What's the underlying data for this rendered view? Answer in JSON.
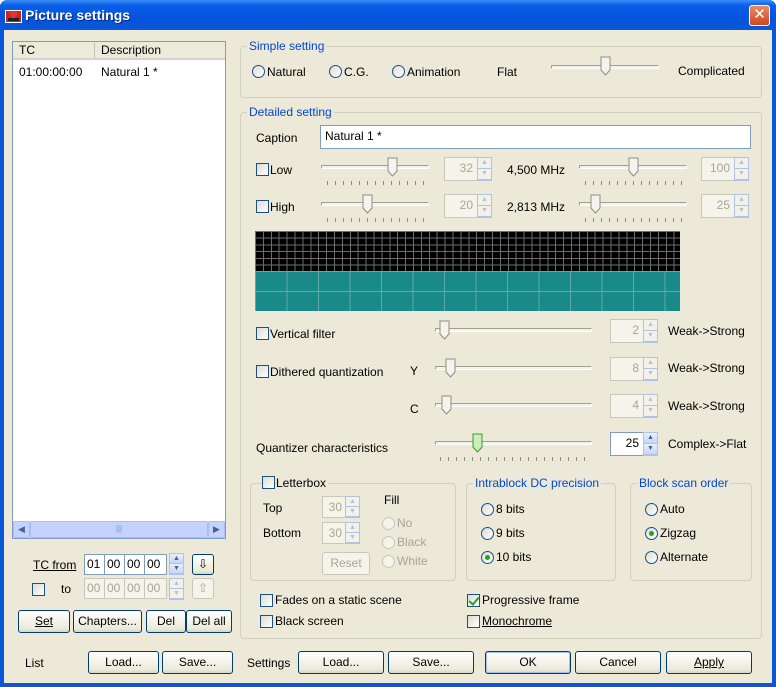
{
  "window": {
    "title": "Picture settings",
    "close_glyph": "✕"
  },
  "list": {
    "headers": [
      "TC",
      "Description"
    ],
    "rows": [
      {
        "tc": "01:00:00:00",
        "description": "Natural 1 *"
      }
    ],
    "tc_from_label": "TC from",
    "to_label": "to",
    "from_fields": [
      "01",
      "00",
      "00",
      "00"
    ],
    "to_fields": [
      "00",
      "00",
      "00",
      "00"
    ],
    "set_label": "Set",
    "chapters_label": "Chapters...",
    "del_label": "Del",
    "del_all_label": "Del all",
    "section_label": "List",
    "load_label": "Load...",
    "save_label": "Save..."
  },
  "simple": {
    "title": "Simple setting",
    "options": [
      "Natural",
      "C.G.",
      "Animation"
    ],
    "flat_label": "Flat",
    "complicated_label": "Complicated"
  },
  "detailed": {
    "title": "Detailed setting",
    "caption_label": "Caption",
    "caption_value": "Natural 1 *",
    "low": {
      "label": "Low",
      "value1": "32",
      "freq": "4,500 MHz",
      "value2": "100"
    },
    "high": {
      "label": "High",
      "value1": "20",
      "freq": "2,813 MHz",
      "value2": "25"
    },
    "vertical_filter": {
      "label": "Vertical filter",
      "value": "2",
      "range": "Weak->Strong"
    },
    "dithered": {
      "label": "Dithered quantization",
      "y_label": "Y",
      "y_value": "8",
      "c_label": "C",
      "c_value": "4",
      "range": "Weak->Strong"
    },
    "quantizer": {
      "label": "Quantizer characteristics",
      "value": "25",
      "range": "Complex->Flat"
    },
    "letterbox": {
      "label": "Letterbox",
      "top_label": "Top",
      "top_value": "30",
      "bottom_label": "Bottom",
      "bottom_value": "30",
      "fill_label": "Fill",
      "fill_options": [
        "No",
        "Black",
        "White"
      ],
      "reset_label": "Reset"
    },
    "intrablock": {
      "title": "Intrablock DC precision",
      "options": [
        "8 bits",
        "9 bits",
        "10 bits"
      ]
    },
    "scan": {
      "title": "Block scan order",
      "options": [
        "Auto",
        "Zigzag",
        "Alternate"
      ]
    },
    "fades_label": "Fades on a static scene",
    "black_screen_label": "Black screen",
    "progressive_label": "Progressive frame",
    "monochrome_label": "Monochrome"
  },
  "footer": {
    "settings_label": "Settings",
    "load_label": "Load...",
    "save_label": "Save...",
    "ok_label": "OK",
    "cancel_label": "Cancel",
    "apply_label": "Apply"
  },
  "colors": {
    "accent": "#0046d5",
    "preview_top": "#000000",
    "preview_bottom": "#1a8a88",
    "title_bar": "#0a58d8"
  }
}
